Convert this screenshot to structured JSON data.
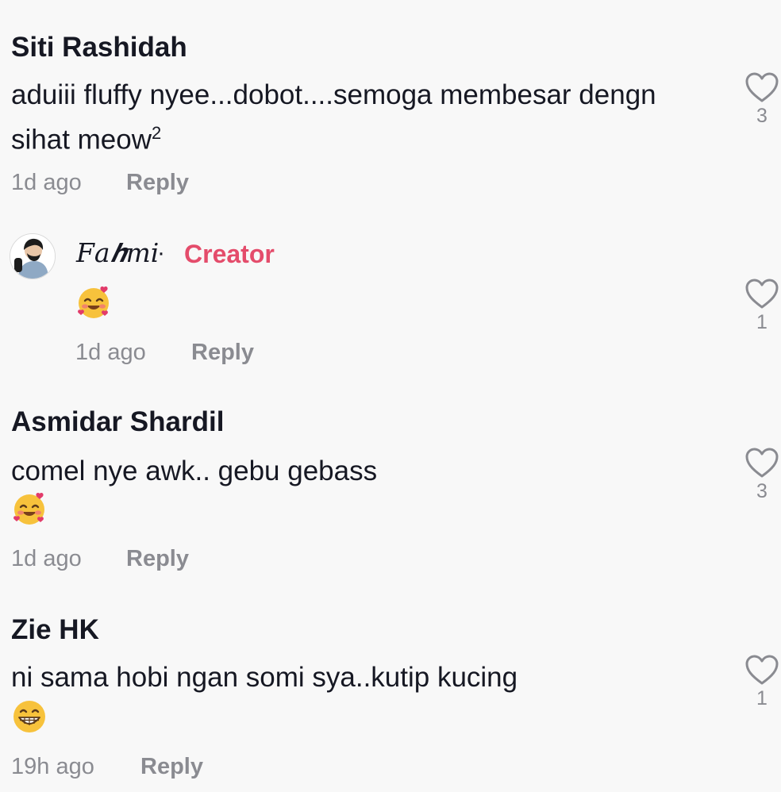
{
  "comments": [
    {
      "username": "Siti Rashidah",
      "text_line1": "aduiii fluffy nyee...dobot....semoga membesar dengn",
      "text_line2": "sihat meow",
      "text_sup": "2",
      "time": "1d ago",
      "reply_label": "Reply",
      "likes": "3"
    },
    {
      "username": "𝐹𝑎𝒉𝑚𝑖",
      "separator": "·",
      "badge": "Creator",
      "emoji_icon": "smiling-face-with-hearts-icon",
      "time": "1d ago",
      "reply_label": "Reply",
      "likes": "1"
    },
    {
      "username": "Asmidar Shardil",
      "text": "comel nye awk.. gebu gebass",
      "emoji_icon": "smiling-face-with-hearts-icon",
      "time": "1d ago",
      "reply_label": "Reply",
      "likes": "3"
    },
    {
      "username": "Zie HK",
      "text": "ni sama hobi ngan somi sya..kutip kucing",
      "emoji_icon": "grinning-face-icon",
      "time": "19h ago",
      "reply_label": "Reply",
      "likes": "1"
    }
  ],
  "colors": {
    "background": "#f8f8f8",
    "text": "#161823",
    "muted": "#8a8b91",
    "creator_accent": "#e44c6b"
  }
}
